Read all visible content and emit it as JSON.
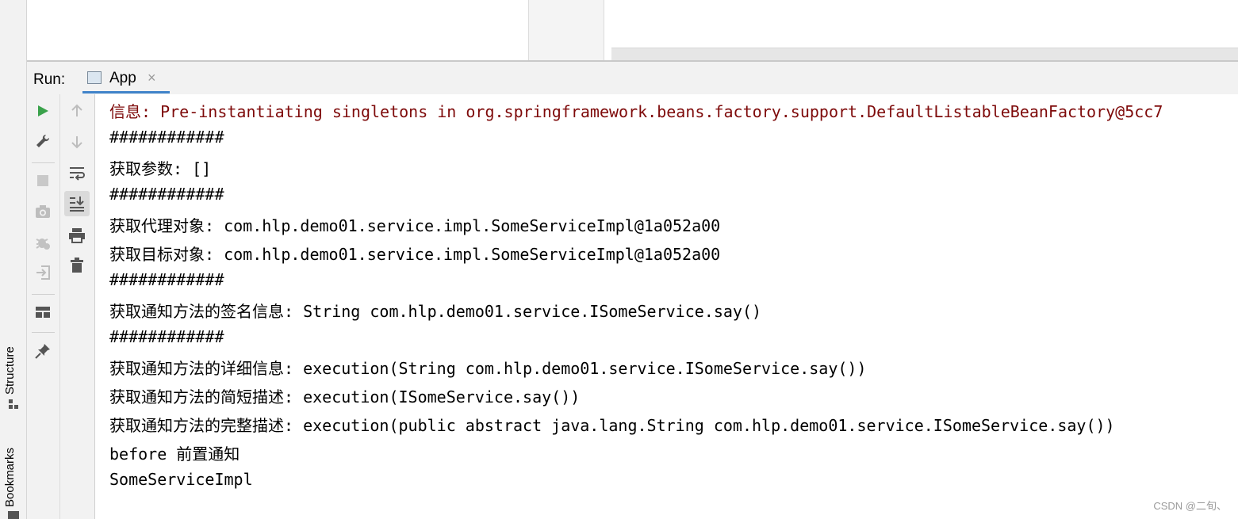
{
  "left_strip": {
    "structure_label": "Structure",
    "bookmarks_label": "Bookmarks"
  },
  "run_header": {
    "label": "Run:",
    "tab_label": "App",
    "close_glyph": "×"
  },
  "toolbar_primary": [
    {
      "name": "run-icon",
      "color": "#3aa24b"
    },
    {
      "name": "wrench-icon"
    },
    {
      "name": "stop-icon"
    },
    {
      "name": "camera-icon"
    },
    {
      "name": "debug-icon"
    },
    {
      "name": "exit-icon"
    },
    {
      "name": "layout-icon"
    },
    {
      "name": "pin-icon"
    }
  ],
  "toolbar_secondary": [
    {
      "name": "arrow-up-icon"
    },
    {
      "name": "arrow-down-icon"
    },
    {
      "name": "soft-wrap-icon"
    },
    {
      "name": "scroll-to-end-icon"
    },
    {
      "name": "print-icon"
    },
    {
      "name": "trash-icon"
    }
  ],
  "console_lines": [
    {
      "text": "信息: Pre-instantiating singletons in org.springframework.beans.factory.support.DefaultListableBeanFactory@5cc7",
      "color": "#7e0a0a"
    },
    {
      "text": "############"
    },
    {
      "text": "获取参数: []"
    },
    {
      "text": "############"
    },
    {
      "text": "获取代理对象: com.hlp.demo01.service.impl.SomeServiceImpl@1a052a00"
    },
    {
      "text": "获取目标对象: com.hlp.demo01.service.impl.SomeServiceImpl@1a052a00"
    },
    {
      "text": "############"
    },
    {
      "text": "获取通知方法的签名信息: String com.hlp.demo01.service.ISomeService.say()"
    },
    {
      "text": "############"
    },
    {
      "text": "获取通知方法的详细信息: execution(String com.hlp.demo01.service.ISomeService.say())"
    },
    {
      "text": "获取通知方法的简短描述: execution(ISomeService.say())"
    },
    {
      "text": "获取通知方法的完整描述: execution(public abstract java.lang.String com.hlp.demo01.service.ISomeService.say())"
    },
    {
      "text": "before 前置通知"
    },
    {
      "text": "SomeServiceImpl"
    }
  ],
  "watermark": "CSDN @二旬、",
  "colors": {
    "accent": "#4083c9",
    "run_green": "#3aa24b",
    "log_red": "#7e0a0a"
  }
}
